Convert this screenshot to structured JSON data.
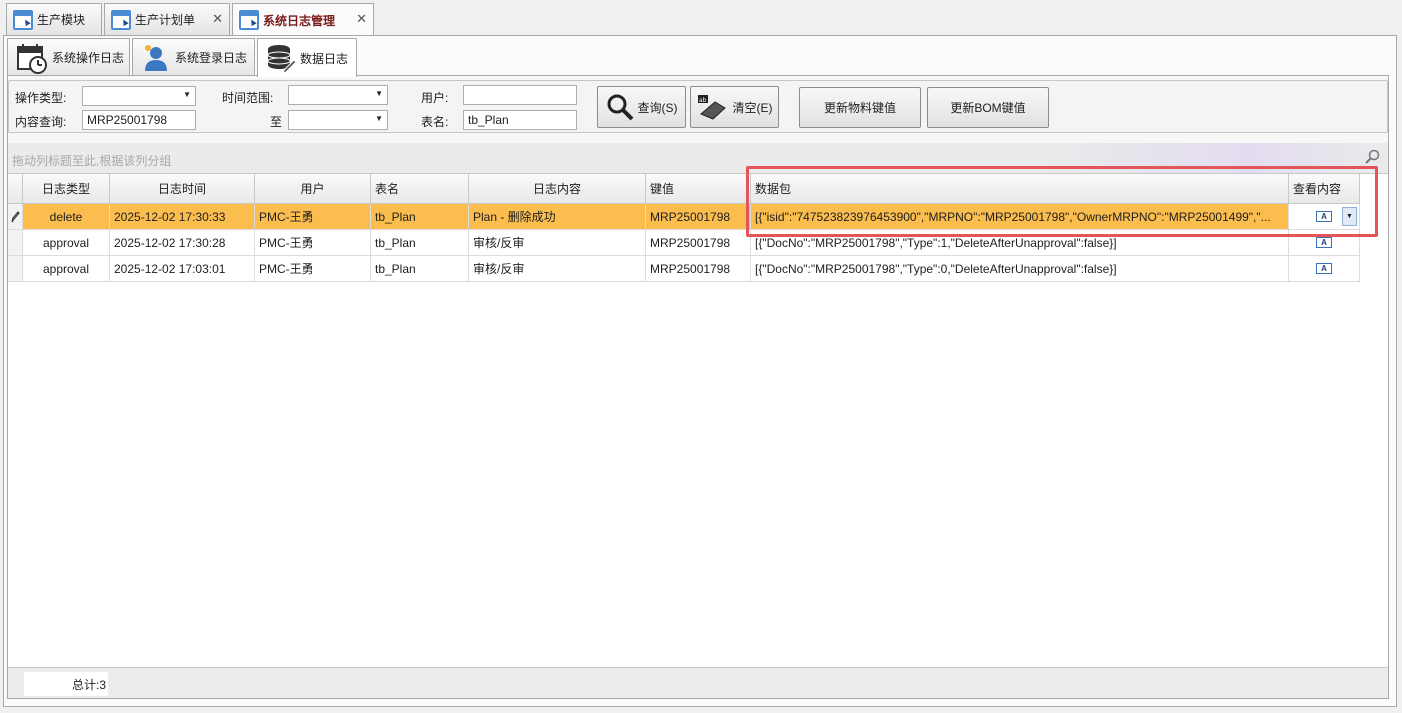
{
  "top_tabs": [
    {
      "label": "生产模块"
    },
    {
      "label": "生产计划单"
    },
    {
      "label": "系统日志管理"
    }
  ],
  "sub_tabs": [
    {
      "label": "系统操作日志",
      "icon": "calendar-clock-icon"
    },
    {
      "label": "系统登录日志",
      "icon": "user-icon"
    },
    {
      "label": "数据日志",
      "icon": "database-pencil-icon"
    }
  ],
  "filters": {
    "op_type_label": "操作类型:",
    "content_label": "内容查询:",
    "content_value": "MRP25001798",
    "time_range_label": "时间范围:",
    "to_label": "至",
    "user_label": "用户:",
    "table_label": "表名:",
    "table_value": "tb_Plan"
  },
  "buttons": {
    "query": "查询(S)",
    "clear": "清空(E)",
    "update_material": "更新物料键值",
    "update_bom": "更新BOM键值"
  },
  "grid": {
    "group_hint": "拖动列标题至此,根据该列分组",
    "columns": [
      "日志类型",
      "日志时间",
      "用户",
      "表名",
      "日志内容",
      "键值",
      "数据包",
      "查看内容"
    ],
    "rows": [
      {
        "type": "delete",
        "time": "2025-12-02 17:30:33",
        "user": "PMC-王勇",
        "table": "tb_Plan",
        "content": "Plan - 删除成功",
        "key": "MRP25001798",
        "package": "[{\"isid\":\"747523823976453900\",\"MRPNO\":\"MRP25001798\",\"OwnerMRPNO\":\"MRP25001499\",\"..."
      },
      {
        "type": "approval",
        "time": "2025-12-02 17:30:28",
        "user": "PMC-王勇",
        "table": "tb_Plan",
        "content": "审核/反审",
        "key": "MRP25001798",
        "package": "[{\"DocNo\":\"MRP25001798\",\"Type\":1,\"DeleteAfterUnapproval\":false}]"
      },
      {
        "type": "approval",
        "time": "2025-12-02 17:03:01",
        "user": "PMC-王勇",
        "table": "tb_Plan",
        "content": "审核/反审",
        "key": "MRP25001798",
        "package": "[{\"DocNo\":\"MRP25001798\",\"Type\":0,\"DeleteAfterUnapproval\":false}]"
      }
    ]
  },
  "footer": {
    "total": "总计:3"
  },
  "colors": {
    "selected_row": "#fbbd4e",
    "highlight": "#e4555a",
    "active_tab_text": "#7a1c1c"
  }
}
